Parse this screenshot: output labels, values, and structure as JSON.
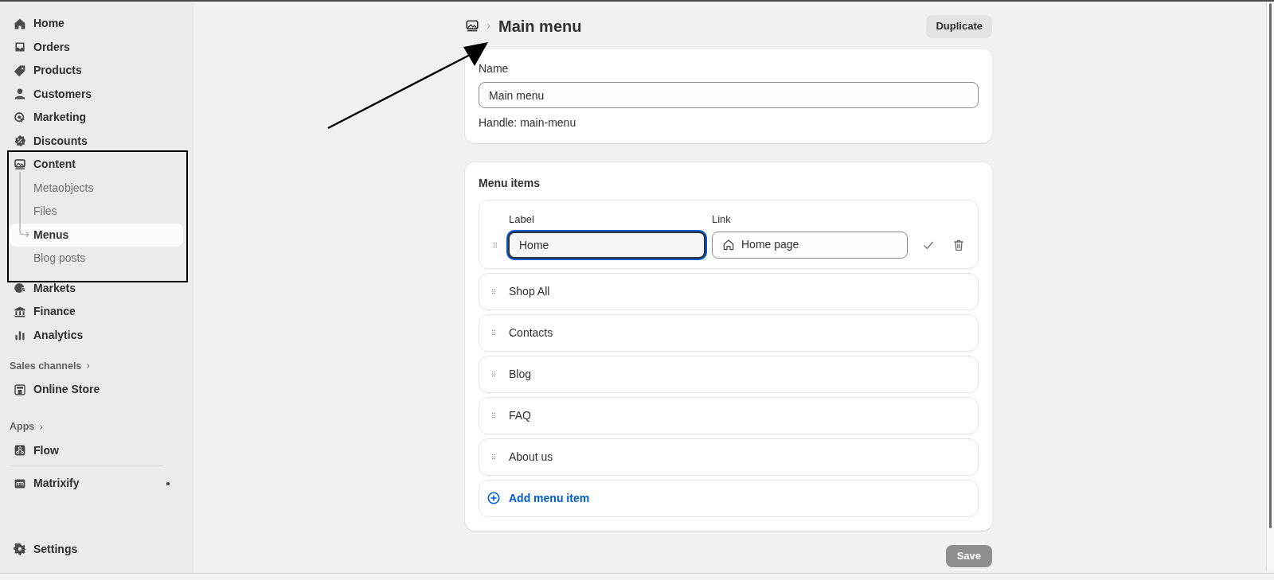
{
  "sidebar": {
    "items": [
      {
        "label": "Home",
        "selected": false
      },
      {
        "label": "Orders",
        "selected": false
      },
      {
        "label": "Products",
        "selected": false
      },
      {
        "label": "Customers",
        "selected": false
      },
      {
        "label": "Marketing",
        "selected": false
      },
      {
        "label": "Discounts",
        "selected": false
      },
      {
        "label": "Content",
        "selected": false,
        "expanded": true,
        "children": [
          {
            "label": "Metaobjects",
            "selected": false
          },
          {
            "label": "Files",
            "selected": false
          },
          {
            "label": "Menus",
            "selected": true
          },
          {
            "label": "Blog posts",
            "selected": false
          }
        ]
      },
      {
        "label": "Markets",
        "selected": false
      },
      {
        "label": "Finance",
        "selected": false
      },
      {
        "label": "Analytics",
        "selected": false
      }
    ],
    "sales_channels": {
      "label": "Sales channels",
      "items": [
        {
          "label": "Online Store",
          "selected": false,
          "notification": false
        }
      ]
    },
    "apps": {
      "label": "Apps",
      "items": [
        {
          "label": "Flow",
          "selected": false,
          "notification": false
        },
        {
          "label": "Matrixify",
          "selected": false,
          "notification": true
        }
      ]
    },
    "settings": {
      "label": "Settings",
      "selected": false
    }
  },
  "header": {
    "title": "Main menu",
    "duplicate_button": "Duplicate"
  },
  "name_card": {
    "label": "Name",
    "value": "Main menu",
    "handle": "Handle: main-menu"
  },
  "menu_items": {
    "title": "Menu items",
    "items": [
      {
        "label": "Home",
        "editing": true,
        "label_heading": "Label",
        "link_heading": "Link",
        "link": "Home page",
        "focused": true
      },
      {
        "label": "Shop All",
        "editing": false
      },
      {
        "label": "Contacts",
        "editing": false
      },
      {
        "label": "Blog",
        "editing": false
      },
      {
        "label": "FAQ",
        "editing": false
      },
      {
        "label": "About us",
        "editing": false
      }
    ],
    "add_button": "Add menu item"
  },
  "save_button": {
    "label": "Save",
    "disabled": true
  },
  "annotations": {
    "arrow": true,
    "frame": true
  }
}
